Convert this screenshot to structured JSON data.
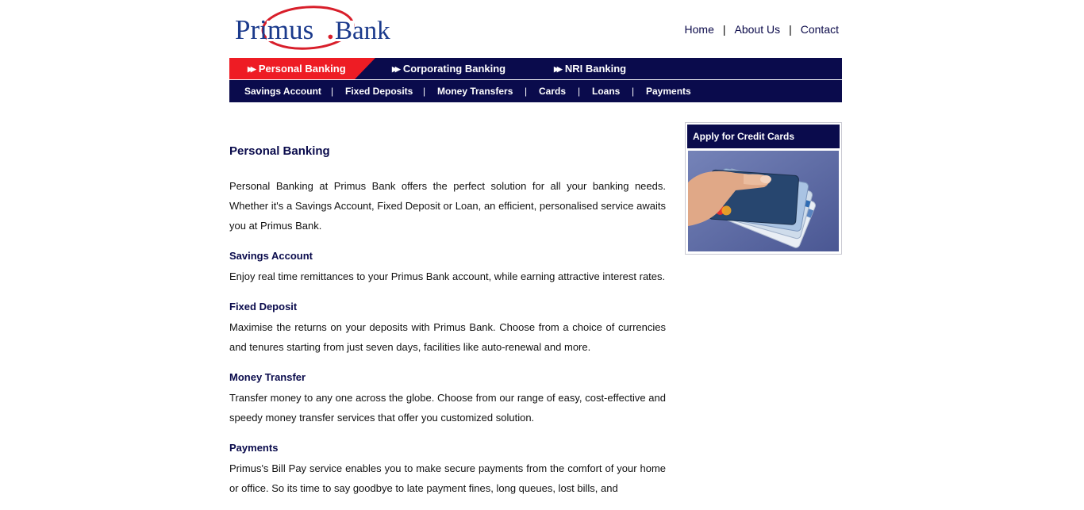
{
  "logo": {
    "word1": "Primus",
    "dot": ".",
    "word2": "Bank"
  },
  "top_links": [
    "Home",
    "About Us",
    "Contact"
  ],
  "top_links_separator": "|",
  "main_nav": [
    {
      "label": "Personal Banking",
      "active": true
    },
    {
      "label": "Corporating Banking",
      "active": false
    },
    {
      "label": "NRI Banking",
      "active": false
    }
  ],
  "sub_nav": [
    "Savings Account",
    "Fixed Deposits",
    "Money Transfers",
    "Cards",
    "Loans",
    "Payments"
  ],
  "sub_nav_separator": "|",
  "content": {
    "title": "Personal Banking",
    "intro": "Personal Banking at Primus Bank offers the perfect solution for all your banking needs. Whether it's a Savings Account, Fixed Deposit or Loan, an efficient, personalised service awaits you at Primus Bank.",
    "sections": [
      {
        "heading": "Savings Account",
        "text": "Enjoy real time remittances to your Primus Bank account, while earning attractive interest rates."
      },
      {
        "heading": "Fixed Deposit",
        "text": "Maximise the returns on your deposits with Primus Bank. Choose from a choice of currencies and tenures starting from just seven days, facilities like auto-renewal and more."
      },
      {
        "heading": "Money Transfer",
        "text": "Transfer money to any one across the globe. Choose from our range of easy, cost-effective and speedy money transfer services that offer you customized solution."
      },
      {
        "heading": "Payments",
        "text": "Primus's Bill Pay service enables you to make secure payments from the comfort of your home or office. So its time to say goodbye to late payment fines, long queues, lost bills, and"
      }
    ]
  },
  "sidebar": {
    "title": "Apply for Credit Cards"
  },
  "colors": {
    "navy": "#0a0b4c",
    "red": "#ee1c24",
    "logo_blue": "#1b3a8c"
  }
}
